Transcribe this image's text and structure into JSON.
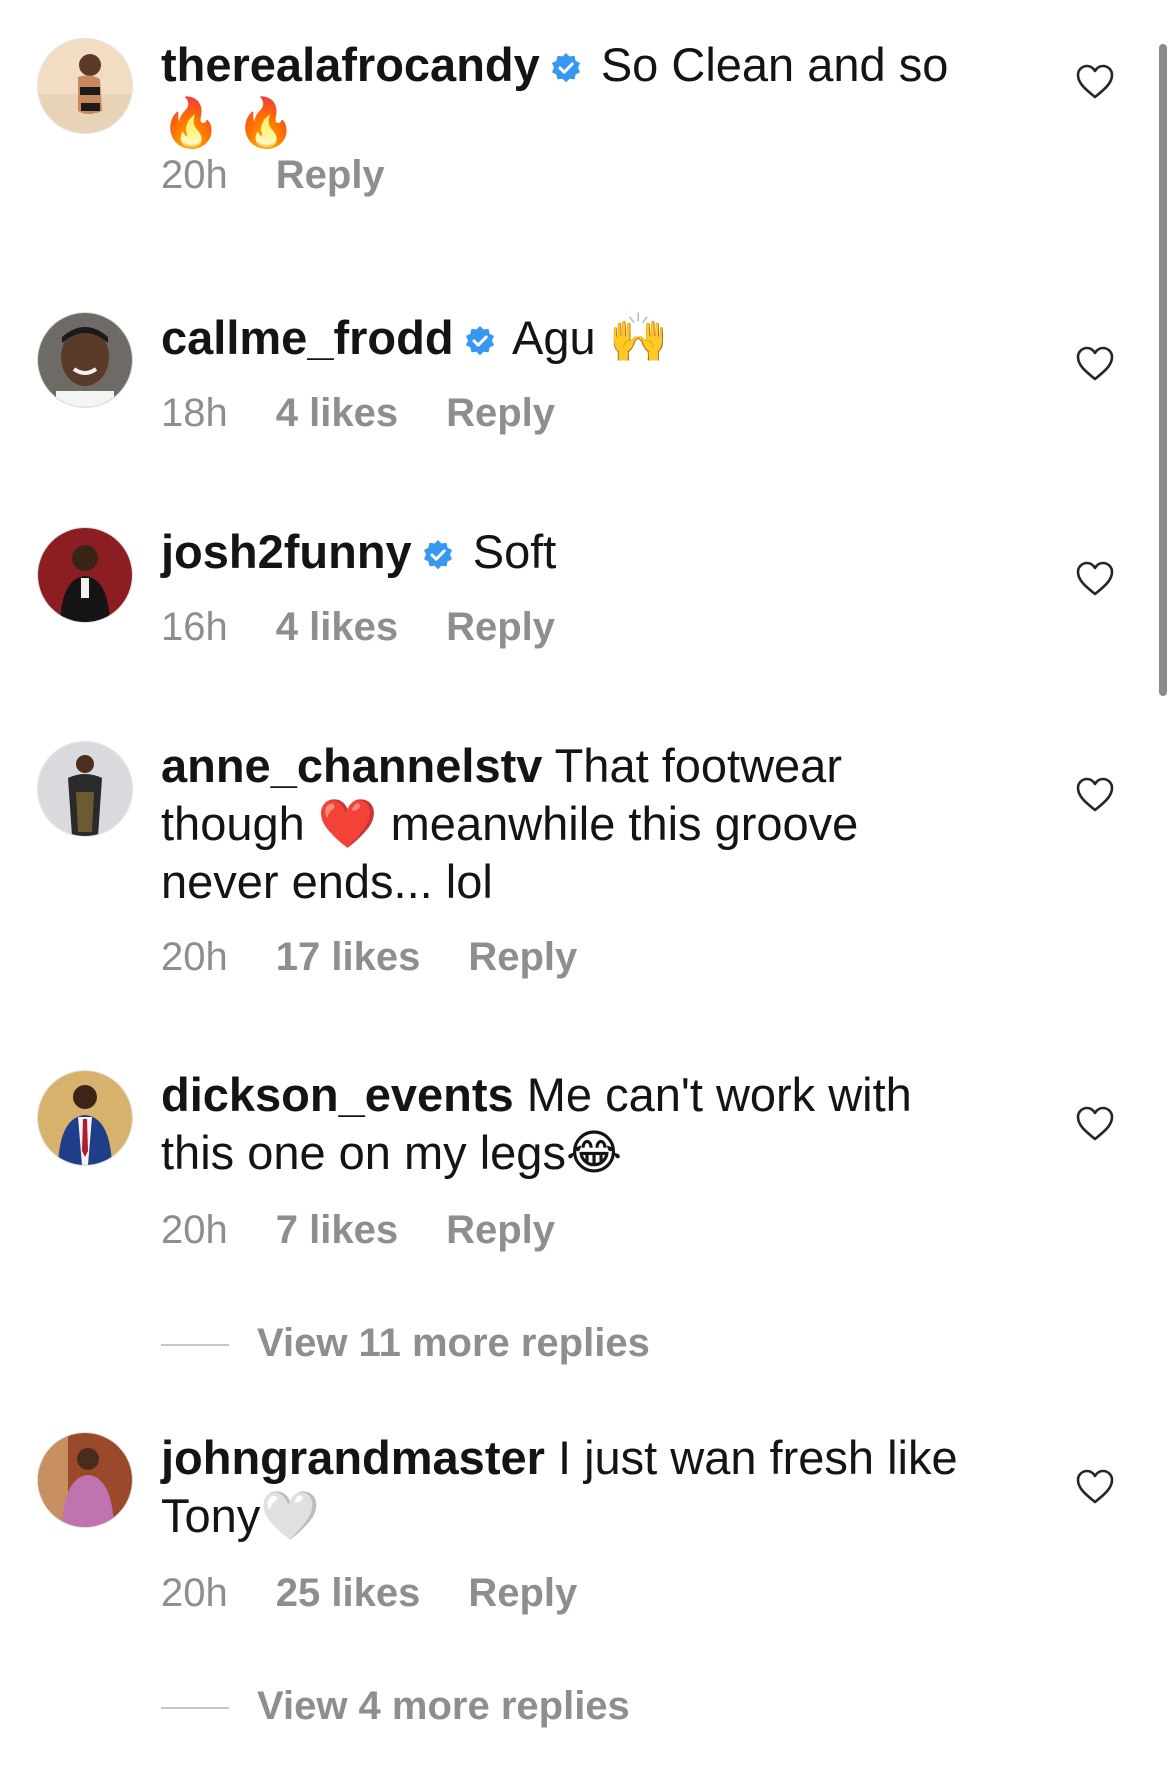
{
  "comments": [
    {
      "username": "therealafrocandy",
      "verified": true,
      "text": "So Clean and so",
      "emoji_line": "🔥 🔥",
      "time": "20h",
      "likes": "",
      "reply": "Reply",
      "avatar_icon": "photo-avatar"
    },
    {
      "username": "callme_frodd",
      "verified": true,
      "text": "Agu",
      "emoji": "🙌",
      "time": "18h",
      "likes": "4 likes",
      "reply": "Reply",
      "avatar_icon": "photo-avatar"
    },
    {
      "username": "josh2funny",
      "verified": true,
      "text": "Soft",
      "time": "16h",
      "likes": "4 likes",
      "reply": "Reply",
      "avatar_icon": "photo-avatar"
    },
    {
      "username": "anne_channelstv",
      "verified": false,
      "text_a": "That footwear",
      "text_b": "though",
      "emoji": "❤️",
      "text_c": "meanwhile this groove",
      "text_d": "never ends... lol",
      "time": "20h",
      "likes": "17 likes",
      "reply": "Reply",
      "avatar_icon": "photo-avatar"
    },
    {
      "username": "dickson_events",
      "verified": false,
      "text_a": "Me can't work with",
      "text_b": "this one on my legs",
      "emoji": "😂",
      "time": "20h",
      "likes": "7 likes",
      "reply": "Reply",
      "view_more": "View 11 more replies",
      "avatar_icon": "photo-avatar"
    },
    {
      "username": "johngrandmaster",
      "verified": false,
      "text_a": "I just wan fresh like",
      "text_b": "Tony",
      "emoji": "🤍",
      "time": "20h",
      "likes": "25 likes",
      "reply": "Reply",
      "view_more": "View 4 more replies",
      "avatar_icon": "photo-avatar"
    }
  ],
  "icons": {
    "like": "heart-outline-icon",
    "verified": "verified-badge-icon"
  },
  "colors": {
    "verified_blue": "#3897f0",
    "meta_gray": "#8e8e8e",
    "text": "#141414"
  }
}
